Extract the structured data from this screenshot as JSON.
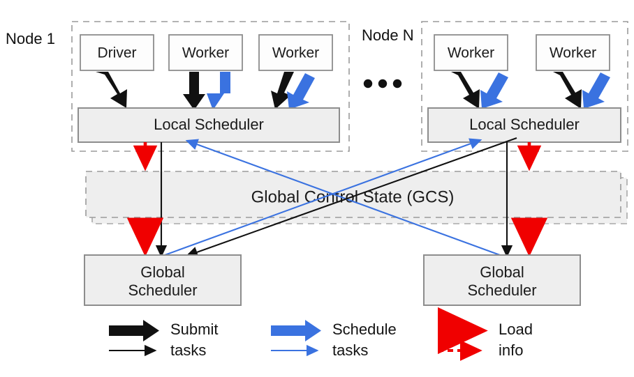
{
  "title": "Ray architecture: nodes, local schedulers, Global Control State and Global Schedulers",
  "colors": {
    "submit": "#111111",
    "schedule": "#3a72e0",
    "load_info": "#f00000",
    "box_fill": "#eeeeee",
    "proc_fill": "#fdfdfd",
    "border": "#8d8d8d",
    "dashed_border": "#9a9a9a",
    "background": "#ffffff"
  },
  "nodes": [
    {
      "label": "Node 1",
      "processes": [
        {
          "label": "Driver",
          "kind": "driver"
        },
        {
          "label": "Worker",
          "kind": "worker"
        },
        {
          "label": "Worker",
          "kind": "worker"
        }
      ],
      "local_scheduler": {
        "label": "Local Scheduler"
      }
    },
    {
      "label": "Node N",
      "processes": [
        {
          "label": "Worker",
          "kind": "worker"
        },
        {
          "label": "Worker",
          "kind": "worker"
        }
      ],
      "local_scheduler": {
        "label": "Local Scheduler"
      }
    }
  ],
  "ellipsis": "•••",
  "gcs": {
    "label": "Global Control State (GCS)",
    "replicas": 2
  },
  "global_schedulers": [
    {
      "line1": "Global",
      "line2": "Scheduler"
    },
    {
      "line1": "Global",
      "line2": "Scheduler"
    }
  ],
  "legend": {
    "items": [
      {
        "line1": "Submit",
        "line2": "tasks",
        "color": "#111111",
        "style": "solid",
        "icon": "thick-arrow-right-icon"
      },
      {
        "line1": "Schedule",
        "line2": "tasks",
        "color": "#3a72e0",
        "style": "solid",
        "icon": "thick-arrow-right-icon"
      },
      {
        "line1": "Load",
        "line2": "info",
        "color": "#f00000",
        "style": "dashed",
        "icon": "dashed-arrow-right-icon"
      }
    ]
  },
  "edges": [
    {
      "name": "driver-to-local-scheduler-1",
      "kind": "submit",
      "from": "Driver (Node 1)",
      "to": "Local Scheduler (Node 1)"
    },
    {
      "name": "worker1-to-local-scheduler-1",
      "kind": "submit",
      "from": "Worker 1 (Node 1)",
      "to": "Local Scheduler (Node 1)"
    },
    {
      "name": "local-scheduler-1-to-worker1",
      "kind": "schedule",
      "from": "Local Scheduler (Node 1)",
      "to": "Worker 1 (Node 1)"
    },
    {
      "name": "worker2-to-local-scheduler-1",
      "kind": "submit",
      "from": "Worker 2 (Node 1)",
      "to": "Local Scheduler (Node 1)"
    },
    {
      "name": "local-scheduler-1-to-worker2",
      "kind": "schedule",
      "from": "Local Scheduler (Node 1)",
      "to": "Worker 2 (Node 1)"
    },
    {
      "name": "worker1-to-local-scheduler-n",
      "kind": "submit",
      "from": "Worker 1 (Node N)",
      "to": "Local Scheduler (Node N)"
    },
    {
      "name": "local-scheduler-n-to-worker1",
      "kind": "schedule",
      "from": "Local Scheduler (Node N)",
      "to": "Worker 1 (Node N)"
    },
    {
      "name": "worker2-to-local-scheduler-n",
      "kind": "submit",
      "from": "Worker 2 (Node N)",
      "to": "Local Scheduler (Node N)"
    },
    {
      "name": "local-scheduler-n-to-worker2",
      "kind": "schedule",
      "from": "Local Scheduler (Node N)",
      "to": "Worker 2 (Node N)"
    },
    {
      "name": "local-scheduler-1-to-global-scheduler-left",
      "kind": "submit",
      "from": "Local Scheduler (Node 1)",
      "to": "Global Scheduler (left)"
    },
    {
      "name": "local-scheduler-n-to-global-scheduler-right",
      "kind": "submit",
      "from": "Local Scheduler (Node N)",
      "to": "Global Scheduler (right)"
    },
    {
      "name": "local-scheduler-n-to-global-scheduler-left",
      "kind": "submit",
      "from": "Local Scheduler (Node N)",
      "to": "Global Scheduler (left)"
    },
    {
      "name": "global-scheduler-right-to-local-scheduler-1",
      "kind": "schedule",
      "from": "Global Scheduler (right)",
      "to": "Local Scheduler (Node 1)"
    },
    {
      "name": "global-scheduler-left-to-local-scheduler-n",
      "kind": "schedule",
      "from": "Global Scheduler (left)",
      "to": "Local Scheduler (Node N)"
    },
    {
      "name": "local-scheduler-1-to-gcs",
      "kind": "load_info",
      "from": "Local Scheduler (Node 1)",
      "to": "GCS"
    },
    {
      "name": "gcs-to-global-scheduler-left",
      "kind": "load_info",
      "from": "GCS",
      "to": "Global Scheduler (left)"
    },
    {
      "name": "local-scheduler-n-to-gcs",
      "kind": "load_info",
      "from": "Local Scheduler (Node N)",
      "to": "GCS"
    },
    {
      "name": "gcs-to-global-scheduler-right",
      "kind": "load_info",
      "from": "GCS",
      "to": "Global Scheduler (right)"
    }
  ]
}
